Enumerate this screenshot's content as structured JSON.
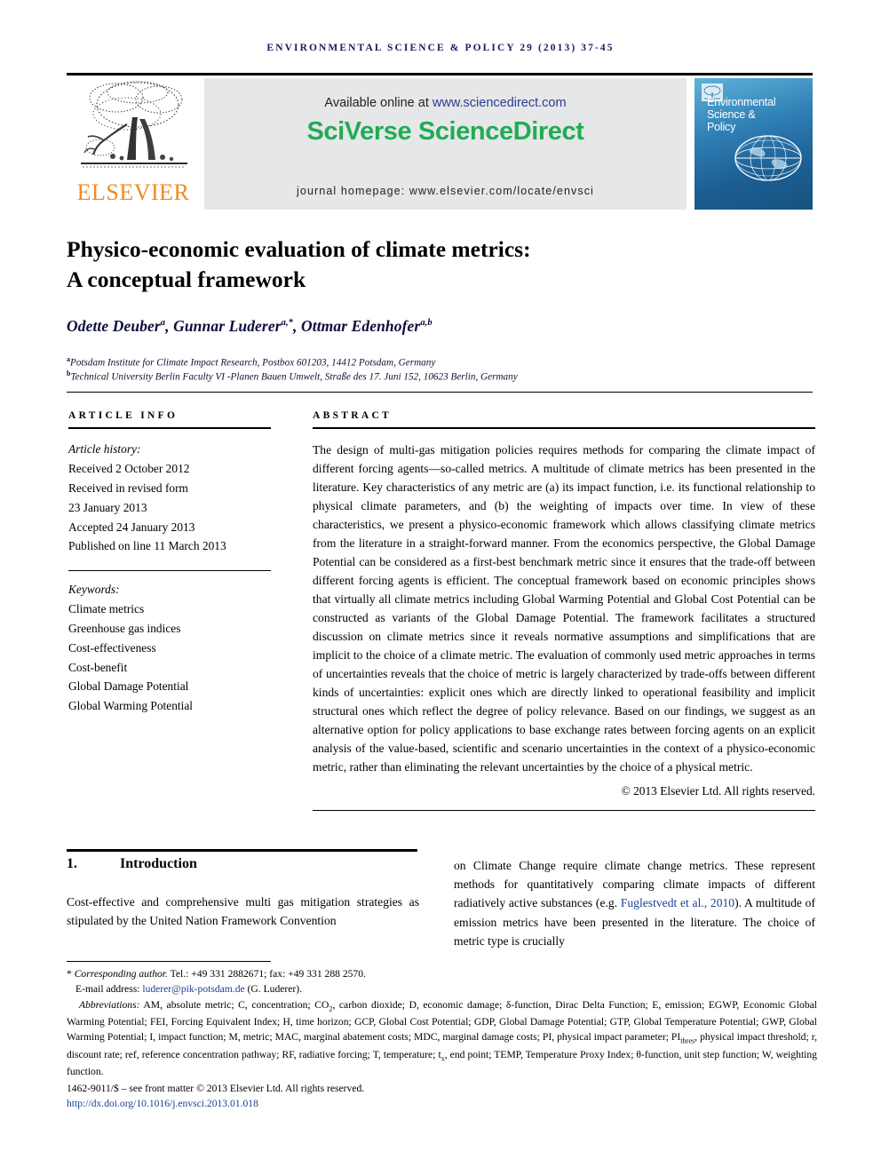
{
  "running_head": "Environmental Science & Policy 29 (2013) 37-45",
  "header": {
    "publisher_name": "ELSEVIER",
    "available_prefix": "Available online at ",
    "available_url": "www.sciencedirect.com",
    "sciverse_part1": "SciVerse ",
    "sciverse_part2": "ScienceDirect",
    "homepage": "journal homepage: www.elsevier.com/locate/envsci",
    "cover_title_line1": "Environmental",
    "cover_title_line2": "Science &",
    "cover_title_line3": "Policy",
    "green_hex": "#22ab55",
    "orange_hex": "#f08a22",
    "navy_hex": "#1a1a5e"
  },
  "article": {
    "title_line1": "Physico-economic evaluation of climate metrics:",
    "title_line2": "A conceptual framework",
    "authors": [
      {
        "name": "Odette Deuber",
        "marks": "a"
      },
      {
        "name": "Gunnar Luderer",
        "marks": "a,*"
      },
      {
        "name": "Ottmar Edenhofer",
        "marks": "a,b"
      }
    ],
    "affiliations": [
      {
        "mark": "a",
        "text": "Potsdam Institute for Climate Impact Research, Postbox 601203, 14412 Potsdam, Germany"
      },
      {
        "mark": "b",
        "text": "Technical University Berlin Faculty VI -Planen Bauen Umwelt, Straße des 17. Juni 152, 10623 Berlin, Germany"
      }
    ]
  },
  "info": {
    "label": "Article info",
    "history_heading": "Article history:",
    "history": [
      "Received 2 October 2012",
      "Received in revised form",
      "23 January 2013",
      "Accepted 24 January 2013",
      "Published on line 11 March 2013"
    ],
    "keywords_heading": "Keywords:",
    "keywords": [
      "Climate metrics",
      "Greenhouse gas indices",
      "Cost-effectiveness",
      "Cost-benefit",
      "Global Damage Potential",
      "Global Warming Potential"
    ]
  },
  "abstract": {
    "label": "Abstract",
    "text": "The design of multi-gas mitigation policies requires methods for comparing the climate impact of different forcing agents—so-called metrics. A multitude of climate metrics has been presented in the literature. Key characteristics of any metric are (a) its impact function, i.e. its functional relationship to physical climate parameters, and (b) the weighting of impacts over time. In view of these characteristics, we present a physico-economic framework which allows classifying climate metrics from the literature in a straight-forward manner. From the economics perspective, the Global Damage Potential can be considered as a first-best benchmark metric since it ensures that the trade-off between different forcing agents is efficient. The conceptual framework based on economic principles shows that virtually all climate metrics including Global Warming Potential and Global Cost Potential can be constructed as variants of the Global Damage Potential. The framework facilitates a structured discussion on climate metrics since it reveals normative assumptions and simplifications that are implicit to the choice of a climate metric. The evaluation of commonly used metric approaches in terms of uncertainties reveals that the choice of metric is largely characterized by trade-offs between different kinds of uncertainties: explicit ones which are directly linked to operational feasibility and implicit structural ones which reflect the degree of policy relevance. Based on our findings, we suggest as an alternative option for policy applications to base exchange rates between forcing agents on an explicit analysis of the value-based, scientific and scenario uncertainties in the context of a physico-economic metric, rather than eliminating the relevant uncertainties by the choice of a physical metric.",
    "copyright": "© 2013 Elsevier Ltd. All rights reserved."
  },
  "body": {
    "section_number": "1.",
    "section_title": "Introduction",
    "left_text": "Cost-effective and comprehensive multi gas mitigation strategies as stipulated by the United Nation Framework Convention",
    "right_text_part1": "on Climate Change require climate change metrics. These represent methods for quantitatively comparing climate impacts of different radiatively active substances (e.g. ",
    "right_citation": "Fuglestvedt et al., 2010",
    "right_text_part2": "). A multitude of emission metrics have been presented in the literature. The choice of metric type is crucially"
  },
  "footnotes": {
    "corresponding_mark": "*",
    "corresponding_label": "Corresponding author.",
    "corresponding_contact": " Tel.: +49 331 2882671; fax: +49 331 288 2570.",
    "email_label": "E-mail address: ",
    "email_address": "luderer@pik-potsdam.de",
    "email_owner": " (G. Luderer).",
    "abbrev_label": "Abbreviations:",
    "abbrev_text_1": " AM, absolute metric; C, concentration; CO",
    "abbrev_text_2": ", carbon dioxide; D, economic damage; δ-function, Dirac Delta Function; E, emission; EGWP, Economic Global Warming Potential; FEI, Forcing Equivalent Index; H, time horizon; GCP, Global Cost Potential; GDP, Global Damage Potential; GTP, Global Temperature Potential; GWP, Global Warming Potential; I, impact function; M, metric; MAC, marginal abatement costs; MDC, marginal damage costs; PI, physical impact parameter; PI",
    "abbrev_sub_thres": "thres",
    "abbrev_text_3": ", physical impact threshold; r, discount rate; ref, reference concentration pathway; RF, radiative forcing; T, temperature; t",
    "abbrev_sub_x": "x",
    "abbrev_text_4": ", end point; TEMP, Temperature Proxy Index; θ-function, unit step function; W, weighting function.",
    "issn_line": "1462-9011/$ – see front matter © 2013 Elsevier Ltd. All rights reserved.",
    "doi": "http://dx.doi.org/10.1016/j.envsci.2013.01.018"
  }
}
